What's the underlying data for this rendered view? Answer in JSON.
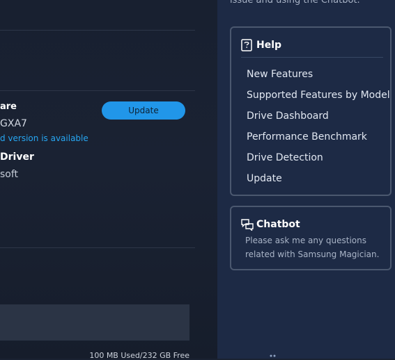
{
  "main": {
    "firmware_title": "are",
    "firmware_version": "GXA7",
    "firmware_status": "d version is available",
    "update_label": "Update",
    "driver_title": "Driver",
    "driver_vendor": "soft",
    "storage_usage": "100 MB Used/232 GB Free"
  },
  "sidebar": {
    "top_text": "issue and using the Chatbot.",
    "help": {
      "title": "Help",
      "items": [
        "New Features",
        "Supported Features by Model",
        "Drive Dashboard",
        "Performance Benchmark",
        "Drive Detection",
        "Update"
      ]
    },
    "chatbot": {
      "title": "Chatbot",
      "description": "Please ask me any questions related with Samsung Magician."
    }
  },
  "colors": {
    "accent": "#2196e9",
    "link": "#27a7f2",
    "panel_bg": "#1d2a45",
    "card_border": "#4b586f"
  },
  "icons": {
    "help": "help-book-icon",
    "chatbot": "chat-bubbles-icon"
  }
}
